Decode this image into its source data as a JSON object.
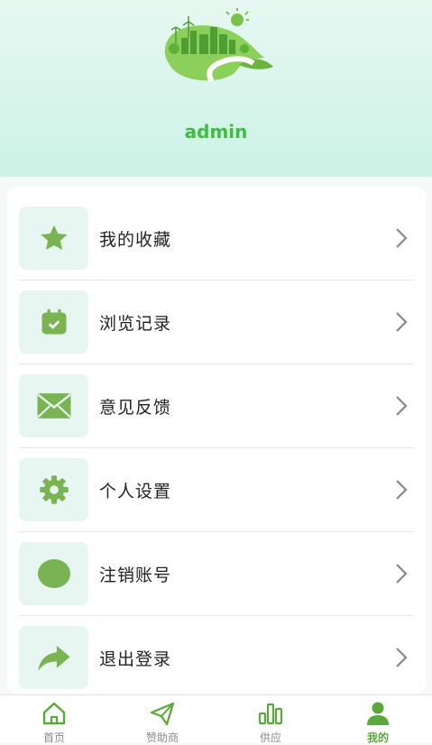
{
  "profile": {
    "username": "admin"
  },
  "menu": {
    "items": [
      {
        "label": "我的收藏",
        "icon": "star-icon"
      },
      {
        "label": "浏览记录",
        "icon": "calendar-check-icon"
      },
      {
        "label": "意见反馈",
        "icon": "envelope-icon"
      },
      {
        "label": "个人设置",
        "icon": "gear-icon"
      },
      {
        "label": "注销账号",
        "icon": "circle-icon"
      },
      {
        "label": "退出登录",
        "icon": "share-arrow-icon"
      }
    ]
  },
  "tabbar": {
    "items": [
      {
        "label": "首页",
        "icon": "home-icon",
        "active": false
      },
      {
        "label": "赞助商",
        "icon": "paper-plane-icon",
        "active": false
      },
      {
        "label": "供应",
        "icon": "bar-chart-icon",
        "active": false
      },
      {
        "label": "我的",
        "icon": "user-icon",
        "active": true
      }
    ]
  },
  "colors": {
    "accent": "#5aa83a",
    "username": "#3cbf3c",
    "icon_green": "#7ab351",
    "icon_bg": "#e7f6f0",
    "header_top": "#e6f8f1",
    "header_bottom": "#cdf2e6"
  }
}
